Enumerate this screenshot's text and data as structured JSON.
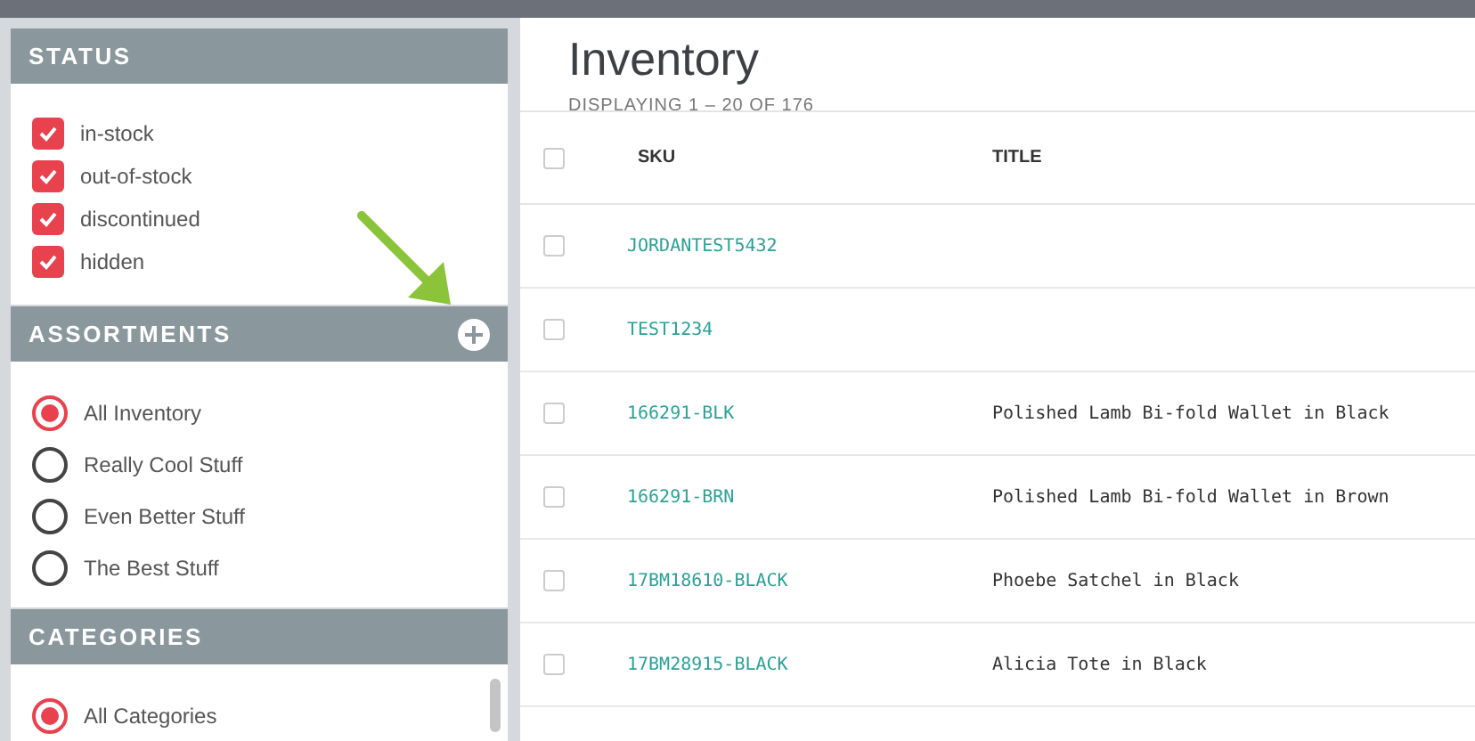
{
  "sidebar": {
    "sections": [
      {
        "title": "STATUS",
        "kind": "checkboxes",
        "items": [
          {
            "label": "in-stock",
            "checked": true
          },
          {
            "label": "out-of-stock",
            "checked": true
          },
          {
            "label": "discontinued",
            "checked": true
          },
          {
            "label": "hidden",
            "checked": true
          }
        ]
      },
      {
        "title": "ASSORTMENTS",
        "kind": "radios",
        "add_button": true,
        "items": [
          {
            "label": "All Inventory",
            "selected": true
          },
          {
            "label": "Really Cool Stuff",
            "selected": false
          },
          {
            "label": "Even Better Stuff",
            "selected": false
          },
          {
            "label": "The Best Stuff",
            "selected": false
          }
        ]
      },
      {
        "title": "CATEGORIES",
        "kind": "radios",
        "items": [
          {
            "label": "All Categories",
            "selected": true
          }
        ]
      }
    ]
  },
  "page": {
    "title": "Inventory",
    "subtitle": "DISPLAYING 1 – 20 OF 176"
  },
  "table": {
    "select_all_checked": false,
    "columns": [
      "SKU",
      "TITLE"
    ],
    "rows": [
      {
        "sku": "JORDANTEST5432",
        "checked": false
      },
      {
        "sku": "TEST1234",
        "checked": false
      },
      {
        "sku": "166291-BLK",
        "title": "Polished Lamb Bi-fold Wallet in Black",
        "checked": false
      },
      {
        "sku": "166291-BRN",
        "title": "Polished Lamb Bi-fold Wallet in Brown",
        "checked": false
      },
      {
        "sku": "17BM18610-BLACK",
        "title": "Phoebe Satchel in Black",
        "checked": false
      },
      {
        "sku": "17BM28915-BLACK",
        "title": "Alicia Tote in Black",
        "checked": false
      }
    ]
  }
}
